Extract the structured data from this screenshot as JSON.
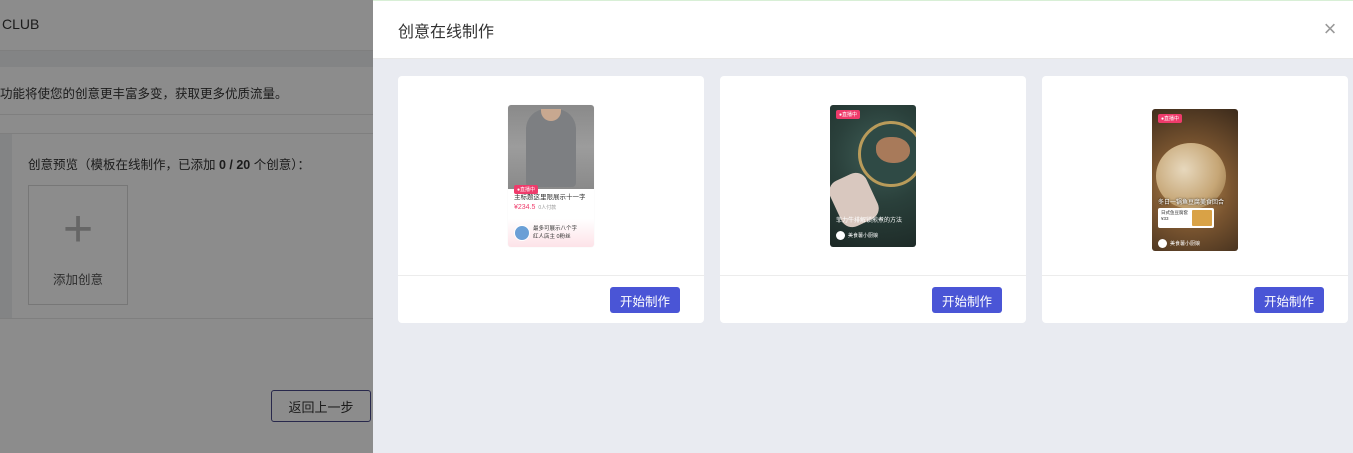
{
  "background_page": {
    "header_text": "CLUB",
    "notice_text": "功能将使您的创意更丰富多变，获取更多优质流量。",
    "preview_title_prefix": "创意预览（模板在线制作，已添加 ",
    "preview_count": "0 / 20",
    "preview_title_suffix": " 个创意）：",
    "add_label": "添加创意",
    "add_plus": "+",
    "back_button": "返回上一步"
  },
  "drawer": {
    "title": "创意在线制作",
    "close_glyph": "×",
    "cards": [
      {
        "button_label": "开始制作",
        "thumbnail": {
          "live_tag": "●直播中",
          "title": "主标题这里限展示十一字",
          "price": "¥234.5",
          "sold": "0人付款",
          "anchor_line1": "最多可展示八个字",
          "anchor_line2": "红人店主   0粉丝"
        }
      },
      {
        "button_label": "开始制作",
        "thumbnail": {
          "live_tag": "●直播中",
          "title": "菲力牛排解锁煎煮的方法",
          "user": "美食薯小厨娘"
        }
      },
      {
        "button_label": "开始制作",
        "thumbnail": {
          "live_tag": "●直播中",
          "title": "冬日一锅鱼豆腐美食回合",
          "product_name": "日式鱼豆腐套",
          "product_price": "¥33",
          "user": "美食薯小厨娘"
        }
      }
    ]
  },
  "colors": {
    "primary_button": "#4a55d6",
    "live_tag": "#ef3b6b",
    "drawer_bg": "#e9ebf1"
  }
}
